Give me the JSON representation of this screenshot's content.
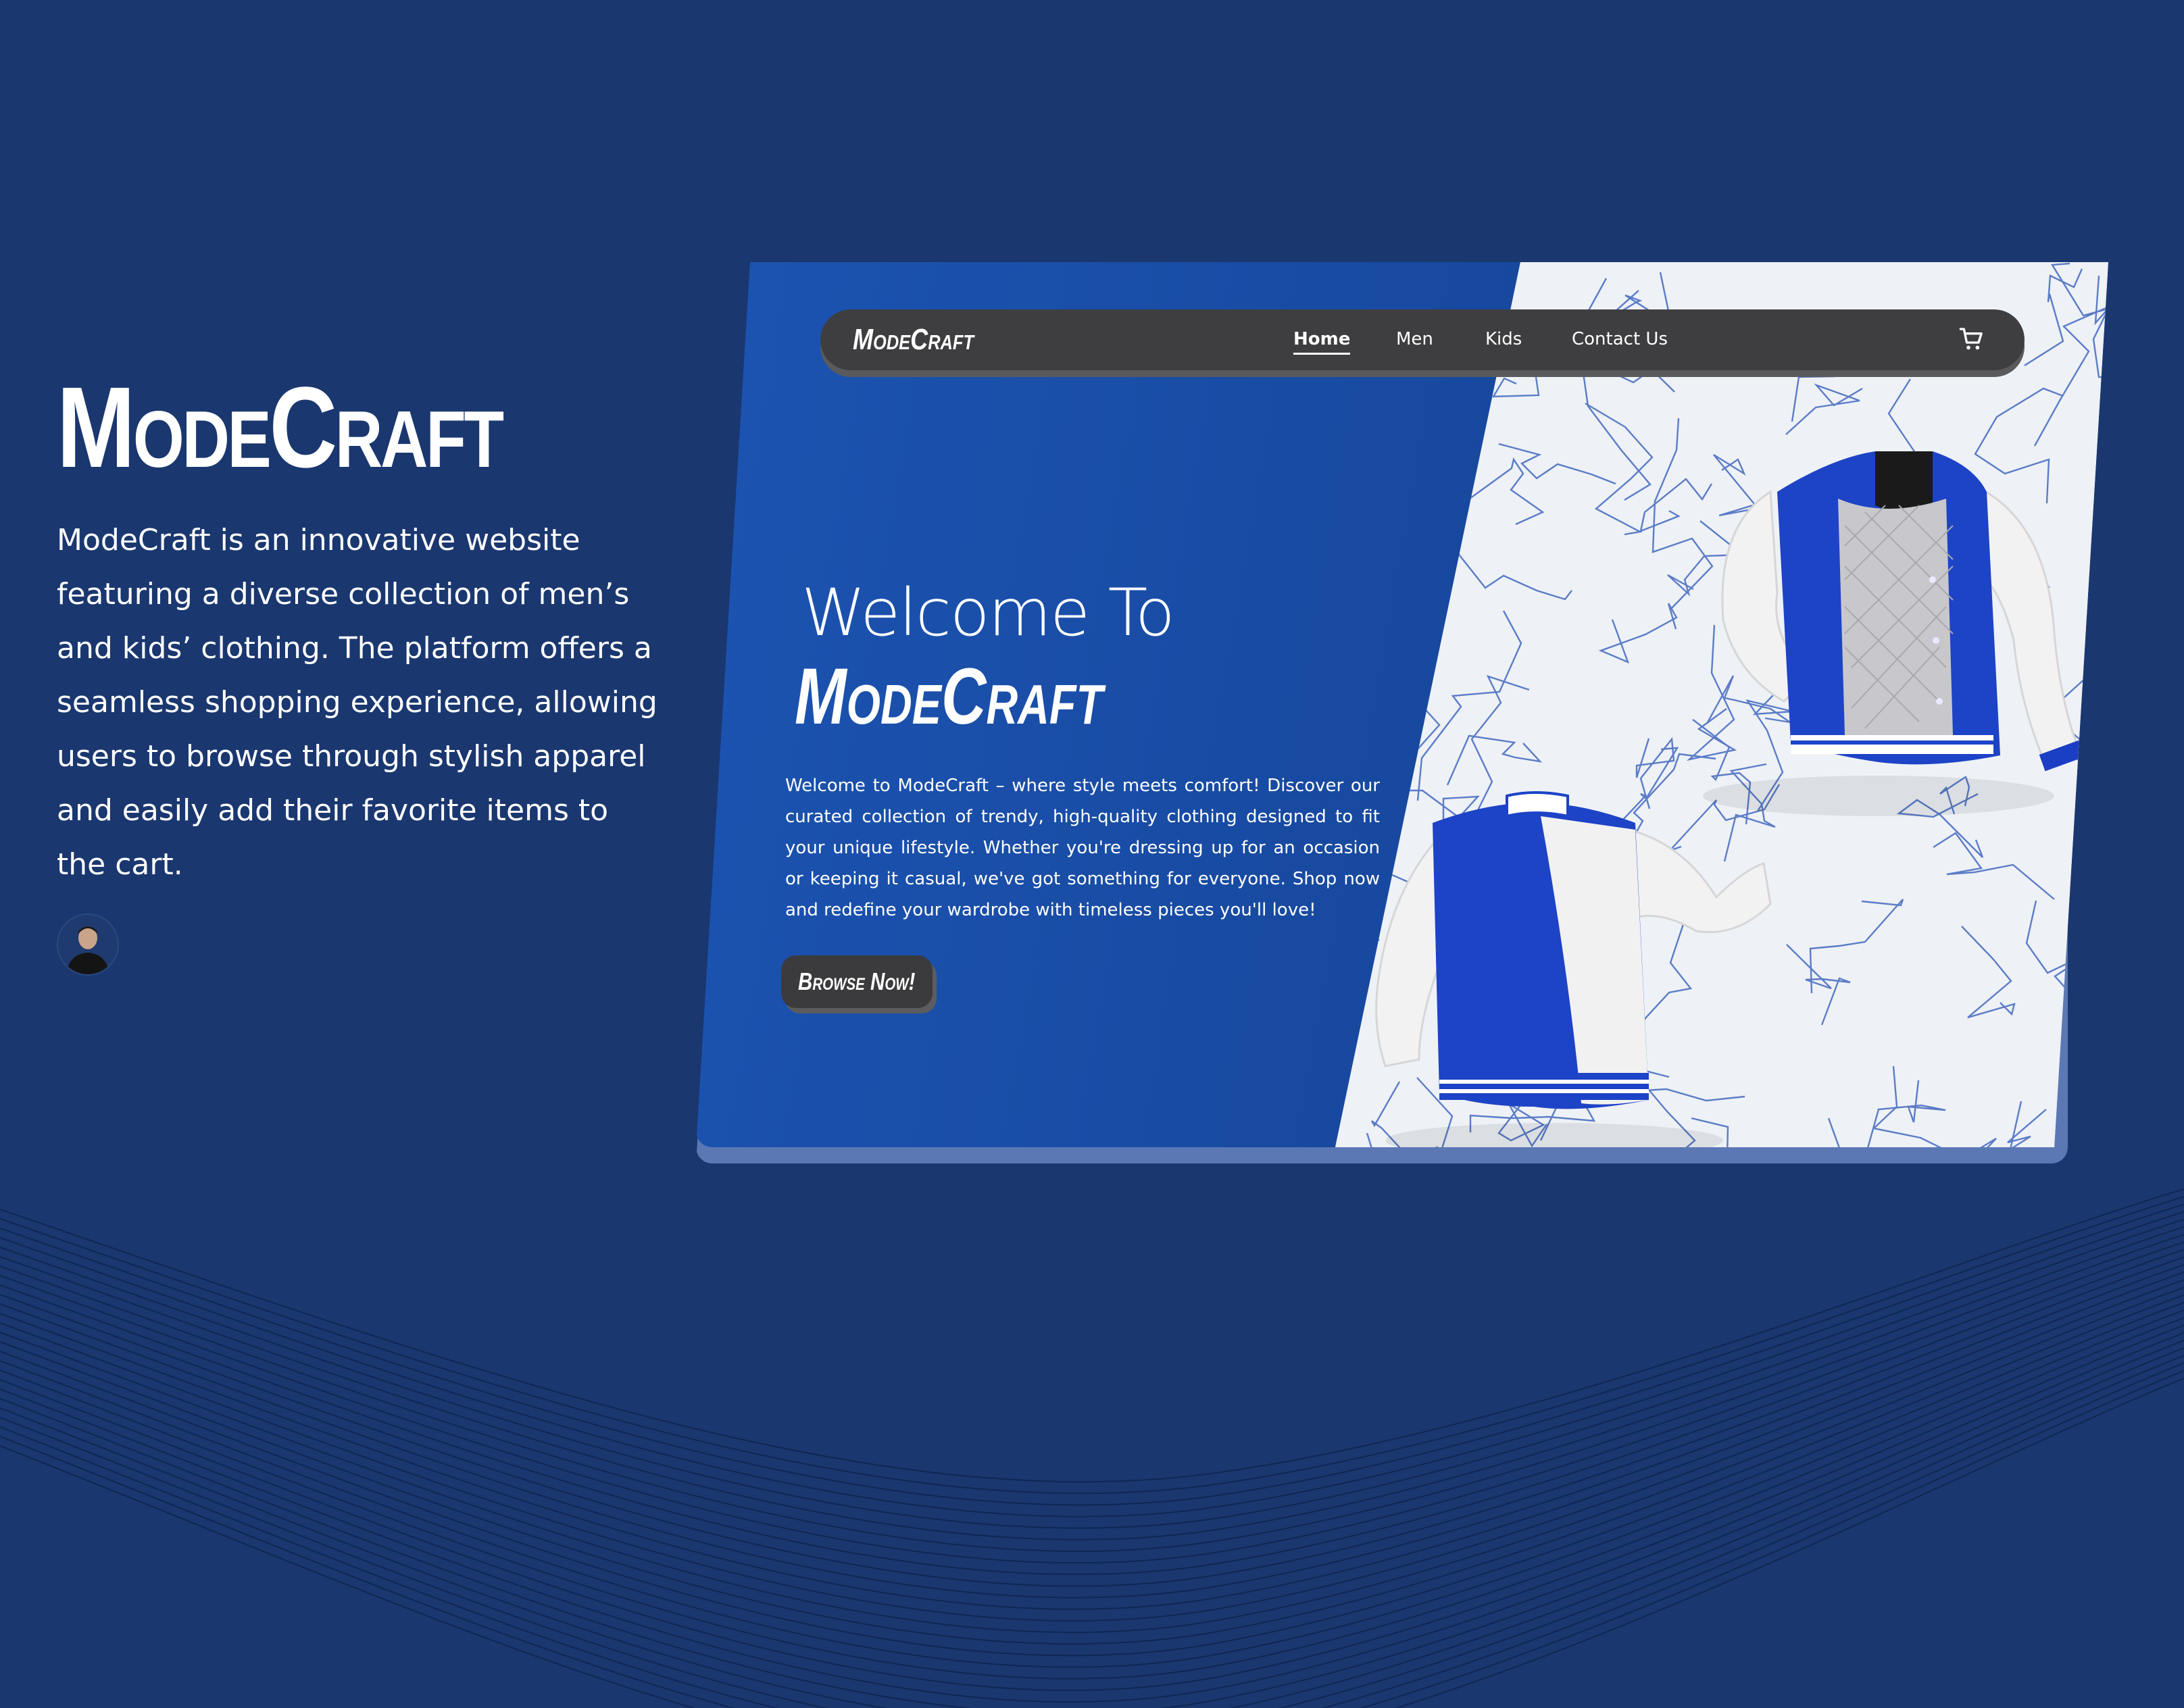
{
  "intro": {
    "title": "ModeCraft",
    "description": "ModeCraft is an innovative website featuring a diverse collection of men’s and kids’ clothing.  The platform offers a seamless shopping experience, allowing users to browse through stylish  apparel and easily add their favorite items to the cart.",
    "avatar_icon": "person-avatar-icon"
  },
  "mockup": {
    "navbar": {
      "logo": "ModeCraft",
      "links": [
        "Home",
        "Men",
        "Kids",
        "Contact Us"
      ],
      "active_link": "Home",
      "cart_icon": "cart-icon"
    },
    "hero": {
      "welcome": "Welcome To",
      "brand": "ModeCraft",
      "text": "Welcome to ModeCraft – where style meets comfort! Discover our curated collection of trendy, high-quality clothing designed to fit your unique lifestyle. Whether you're dressing up for an occasion or keeping it casual, we've got something for everyone. Shop now and redefine your wardrobe with timeless pieces you'll love!",
      "cta_label": "Browse Now!"
    },
    "image_icon": "varsity-jacket-icon"
  },
  "colors": {
    "page_background": "#1a376f",
    "card_blue": "#17489e",
    "navbar": "#3e3e40",
    "jacket_blue": "#1a3fc4",
    "jacket_white": "#f0f0f0"
  }
}
